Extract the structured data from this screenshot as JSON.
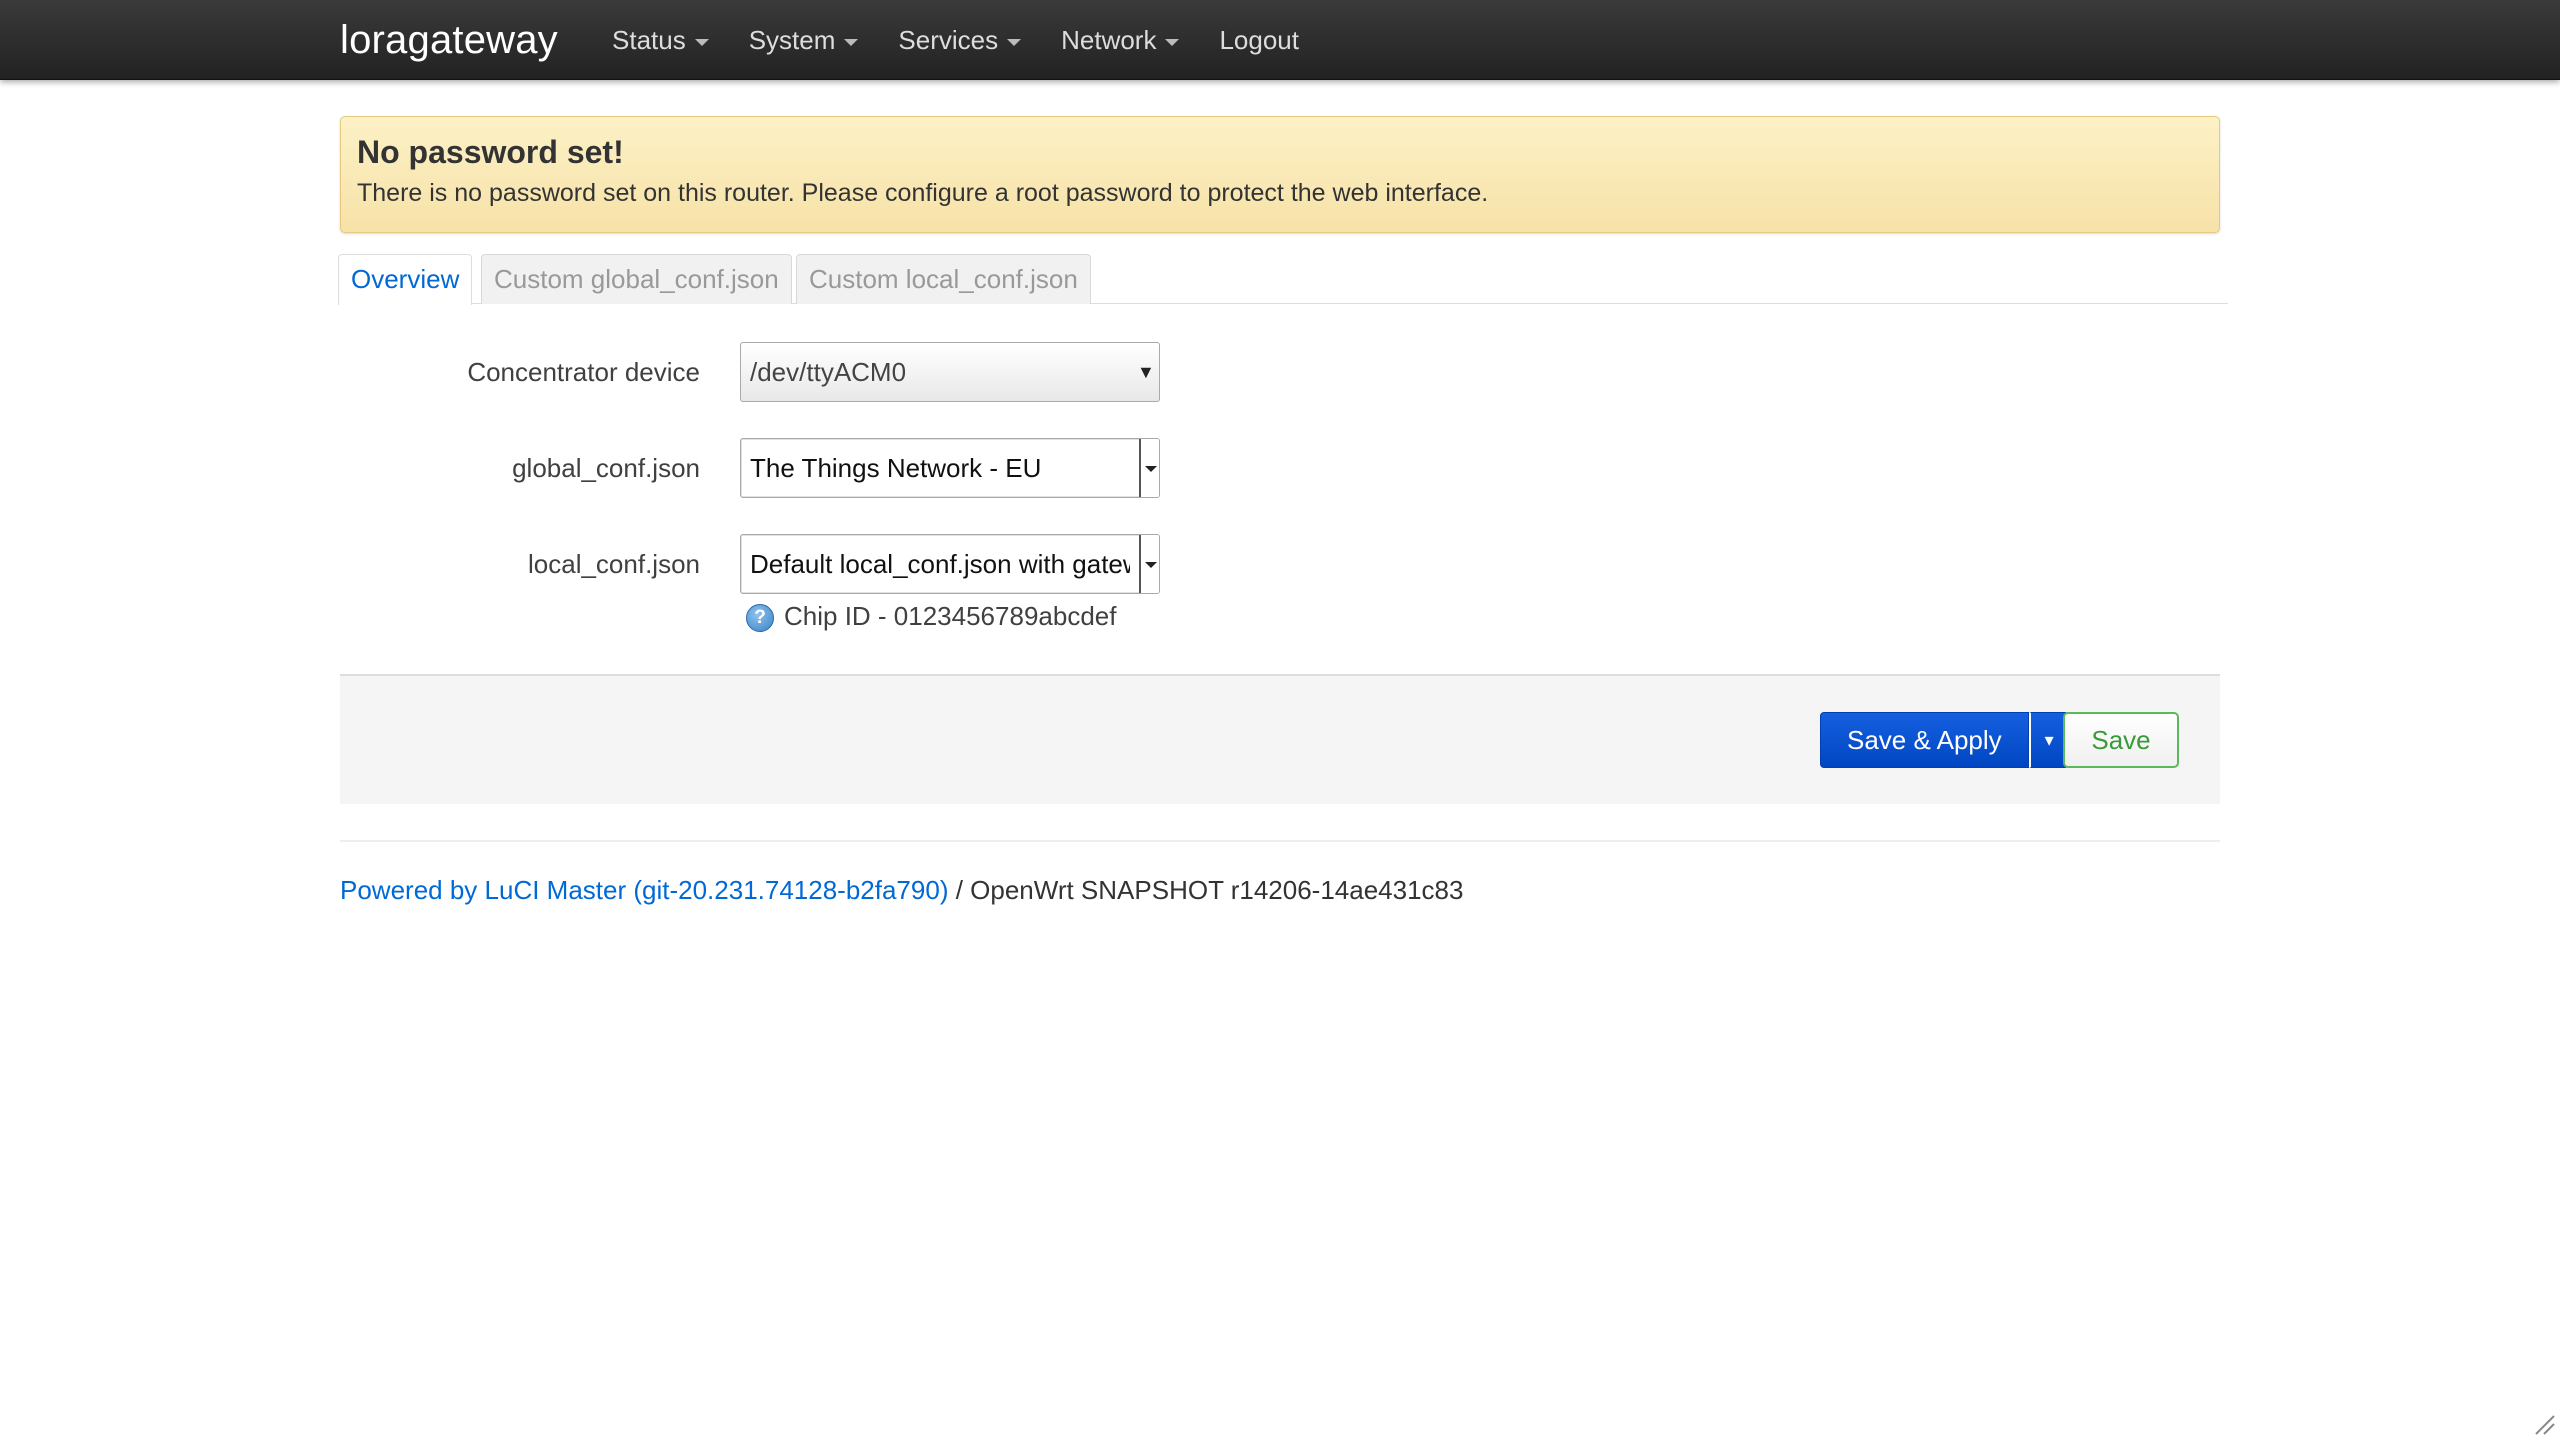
{
  "brand": "loragateway",
  "nav": {
    "items": [
      {
        "label": "Status",
        "dropdown": true
      },
      {
        "label": "System",
        "dropdown": true
      },
      {
        "label": "Services",
        "dropdown": true
      },
      {
        "label": "Network",
        "dropdown": true
      },
      {
        "label": "Logout",
        "dropdown": false
      }
    ]
  },
  "alert": {
    "title": "No password set!",
    "message": "There is no password set on this router. Please configure a root password to protect the web interface."
  },
  "tabs": [
    {
      "label": "Overview",
      "active": true
    },
    {
      "label": "Custom global_conf.json",
      "active": false
    },
    {
      "label": "Custom local_conf.json",
      "active": false
    }
  ],
  "form": {
    "concentrator": {
      "label": "Concentrator device",
      "value": "/dev/ttyACM0"
    },
    "global_conf": {
      "label": "global_conf.json",
      "value": "The Things Network - EU"
    },
    "local_conf": {
      "label": "local_conf.json",
      "value": "Default local_conf.json with gatew"
    },
    "hint": "Chip ID - 0123456789abcdef"
  },
  "actions": {
    "save_apply": "Save & Apply",
    "save_apply_dropdown": "▾",
    "save": "Save"
  },
  "footer": {
    "link": "Powered by LuCI Master (git-20.231.74128-b2fa790)",
    "text": " / OpenWrt SNAPSHOT r14206-14ae431c83"
  },
  "colors": {
    "primary": "#0046c2",
    "link": "#0069d6",
    "alert_bg": "#f9e9b5",
    "save_border": "#5cb85c"
  }
}
